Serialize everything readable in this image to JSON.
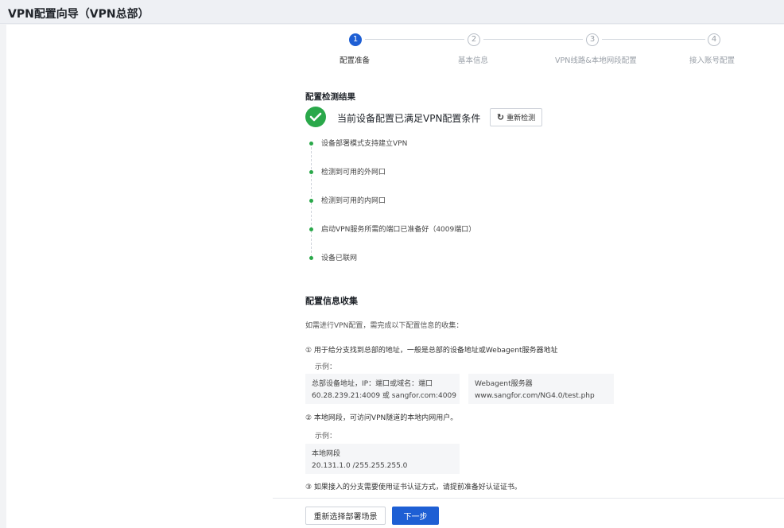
{
  "window": {
    "title": "VPN配置向导（VPN总部）"
  },
  "steps": [
    {
      "number": "1",
      "label": "配置准备",
      "active": true
    },
    {
      "number": "2",
      "label": "基本信息",
      "active": false
    },
    {
      "number": "3",
      "label": "VPN线路&本地网段配置",
      "active": false
    },
    {
      "number": "4",
      "label": "接入账号配置",
      "active": false
    }
  ],
  "detection": {
    "title": "配置检测结果",
    "status_text": "当前设备配置已满足VPN配置条件",
    "recheck_label": "重新检测",
    "items": [
      "设备部署模式支持建立VPN",
      "检测到可用的外网口",
      "检测到可用的内网口",
      "启动VPN服务所需的端口已准备好（4009端口）",
      "设备已联网"
    ]
  },
  "info": {
    "title": "配置信息收集",
    "intro": "如需进行VPN配置，需完成以下配置信息的收集：",
    "item1": "① 用于给分支找到总部的地址，一般是总部的设备地址或Webagent服务器地址",
    "example_label": "示例：",
    "example1a_line1": "总部设备地址，IP：端口或域名：端口",
    "example1a_line2": "60.28.239.21:4009 或 sangfor.com:4009",
    "example1b_line1": "Webagent服务器",
    "example1b_line2": "www.sangfor.com/NG4.0/test.php",
    "item2": "② 本地网段，可访问VPN隧道的本地内网用户。",
    "example2_line1": "本地网段",
    "example2_line2": "20.131.1.0 /255.255.255.0",
    "item3": "③ 如果接入的分支需要使用证书认证方式，请提前准备好认证证书。"
  },
  "footer": {
    "reselect_label": "重新选择部署场景",
    "next_label": "下一步"
  },
  "colors": {
    "primary": "#1e5fd4",
    "success": "#2aa84a"
  }
}
